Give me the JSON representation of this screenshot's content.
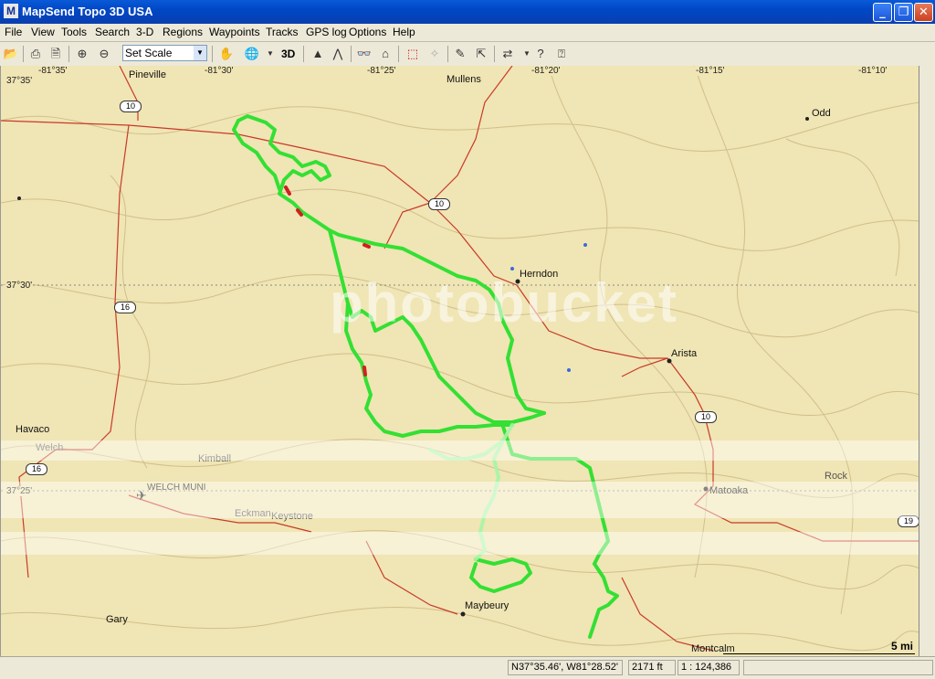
{
  "window": {
    "title": "MapSend Topo 3D USA",
    "icon_letter": "M"
  },
  "menu": [
    "File",
    "View",
    "Tools",
    "Search",
    "3-D",
    "Regions",
    "Waypoints",
    "Tracks",
    "GPS log",
    "Options",
    "Help"
  ],
  "toolbar": {
    "scale_value": "Set Scale",
    "btn_3d": "3D"
  },
  "map": {
    "top_coords": [
      "-81°35'",
      "-81°30'",
      "-81°25'",
      "-81°20'",
      "-81°15'",
      "-81°10'"
    ],
    "left_coords": [
      "37°35'",
      "37°30'",
      "37°25'"
    ],
    "towns": [
      "Pineville",
      "Mullens",
      "Odd",
      "Herndon",
      "Arista",
      "Havaco",
      "Welch",
      "Kimball",
      "WELCH MUNI",
      "Eckman",
      "Keystone",
      "Matoaka",
      "Rock",
      "Maybeury",
      "Gary",
      "Montcalm"
    ],
    "road_shields": [
      "10",
      "10",
      "16",
      "10",
      "16",
      "19"
    ],
    "scale_label": "5 mi",
    "watermark": "photobucket",
    "colors": {
      "track": "#33e033",
      "track_dark": "#22c022",
      "road": "#c83a2a",
      "background": "#f0e5b4"
    }
  },
  "status": {
    "position": "N37°35.46', W81°28.52'",
    "elevation": "2171 ft",
    "scale": "1 : 124,386"
  }
}
